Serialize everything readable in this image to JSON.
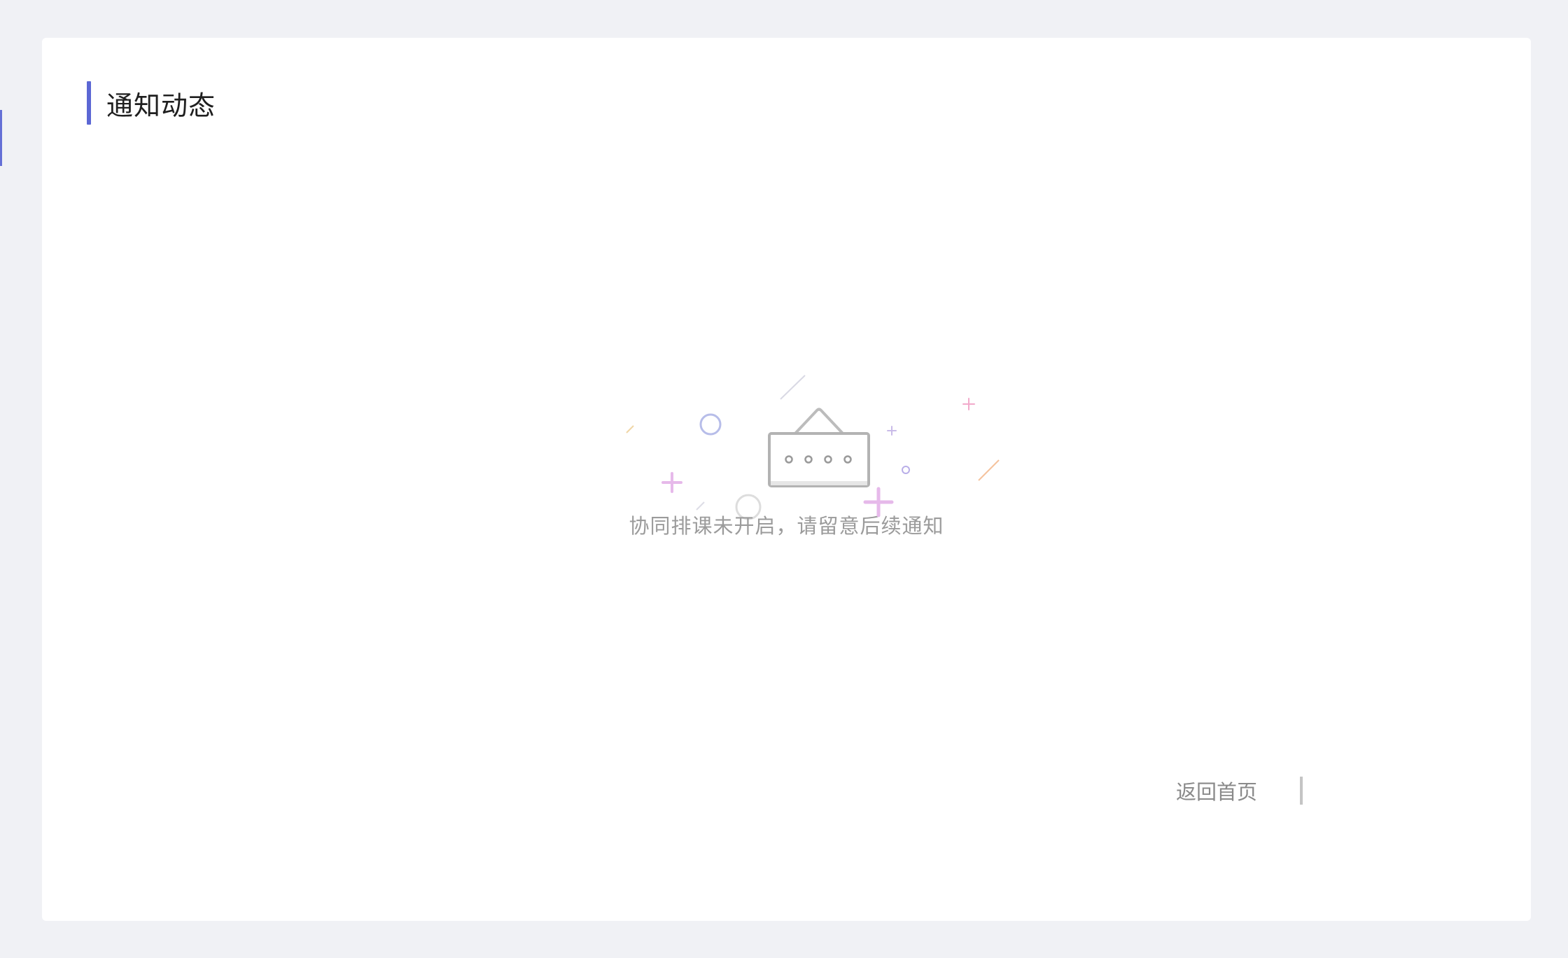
{
  "header": {
    "title": "通知动态"
  },
  "empty_state": {
    "message": "协同排课未开启，请留意后续通知",
    "icon": "empty-signboard-icon"
  },
  "actions": {
    "back_home_label": "返回首页"
  },
  "colors": {
    "accent": "#5b67d4",
    "page_background": "#f0f1f5",
    "card_background": "#ffffff",
    "muted_text": "#9b9b9b"
  }
}
